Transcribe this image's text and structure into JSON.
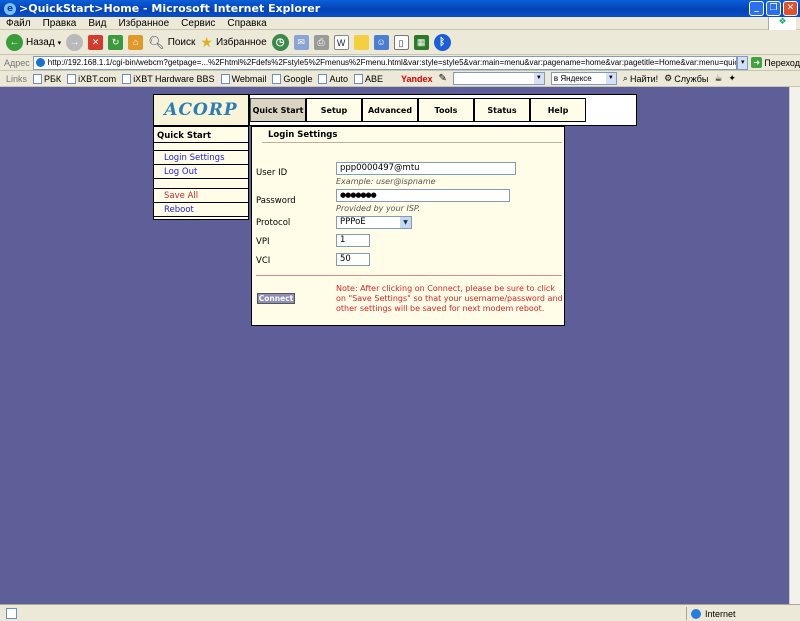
{
  "window": {
    "title": ">QuickStart>Home - Microsoft Internet Explorer",
    "win_buttons": [
      "_",
      "❐",
      "✕"
    ]
  },
  "menubar": [
    "Файл",
    "Правка",
    "Вид",
    "Избранное",
    "Сервис",
    "Справка"
  ],
  "toolbar": {
    "back": "Назад",
    "search": "Поиск",
    "favorites": "Избранное"
  },
  "address": {
    "label": "Адрес",
    "url": "http://192.168.1.1/cgi-bin/webcm?getpage=...%2Fhtml%2Fdefs%2Fstyle5%2Fmenus%2Fmenu.html&var:style=style5&var:main=menu&var:pagename=home&var:pagetitle=Home&var:menu=quickstart&var:menutitle=QuickStart",
    "go": "Переход"
  },
  "links": {
    "label": "Links",
    "items": [
      "РБК",
      "iXBT.com",
      "iXBT Hardware BBS",
      "Webmail",
      "Google",
      "Auto",
      "ABE"
    ],
    "yandex": "Yandex",
    "search_scope": "в Яндексе",
    "find": "Найти!",
    "services": "Службы"
  },
  "status": {
    "zone": "Internet"
  },
  "router": {
    "logo": "ACORP",
    "tabs": [
      {
        "label": "Quick Start"
      },
      {
        "label": "Setup"
      },
      {
        "label": "Advanced"
      },
      {
        "label": "Tools"
      },
      {
        "label": "Status"
      },
      {
        "label": "Help"
      }
    ],
    "sidebar": {
      "heading": "Quick Start",
      "items": [
        "Login Settings",
        "Log Out",
        "Save All",
        "Reboot"
      ]
    },
    "main": {
      "title": "Login Settings",
      "user_id_label": "User ID",
      "user_id_value": "ppp0000497@mtu",
      "user_id_hint": "Example: user@ispname",
      "password_label": "Password",
      "password_value": "●●●●●●●",
      "password_hint": "Provided by your ISP.",
      "protocol_label": "Protocol",
      "protocol_value": "PPPoE",
      "vpi_label": "VPI",
      "vpi_value": "1",
      "vci_label": "VCI",
      "vci_value": "50",
      "connect_label": "Connect",
      "note": "Note: After clicking on Connect, please be sure to click on \"Save Settings\" so that your username/password and other settings will be saved for next modem reboot."
    }
  }
}
